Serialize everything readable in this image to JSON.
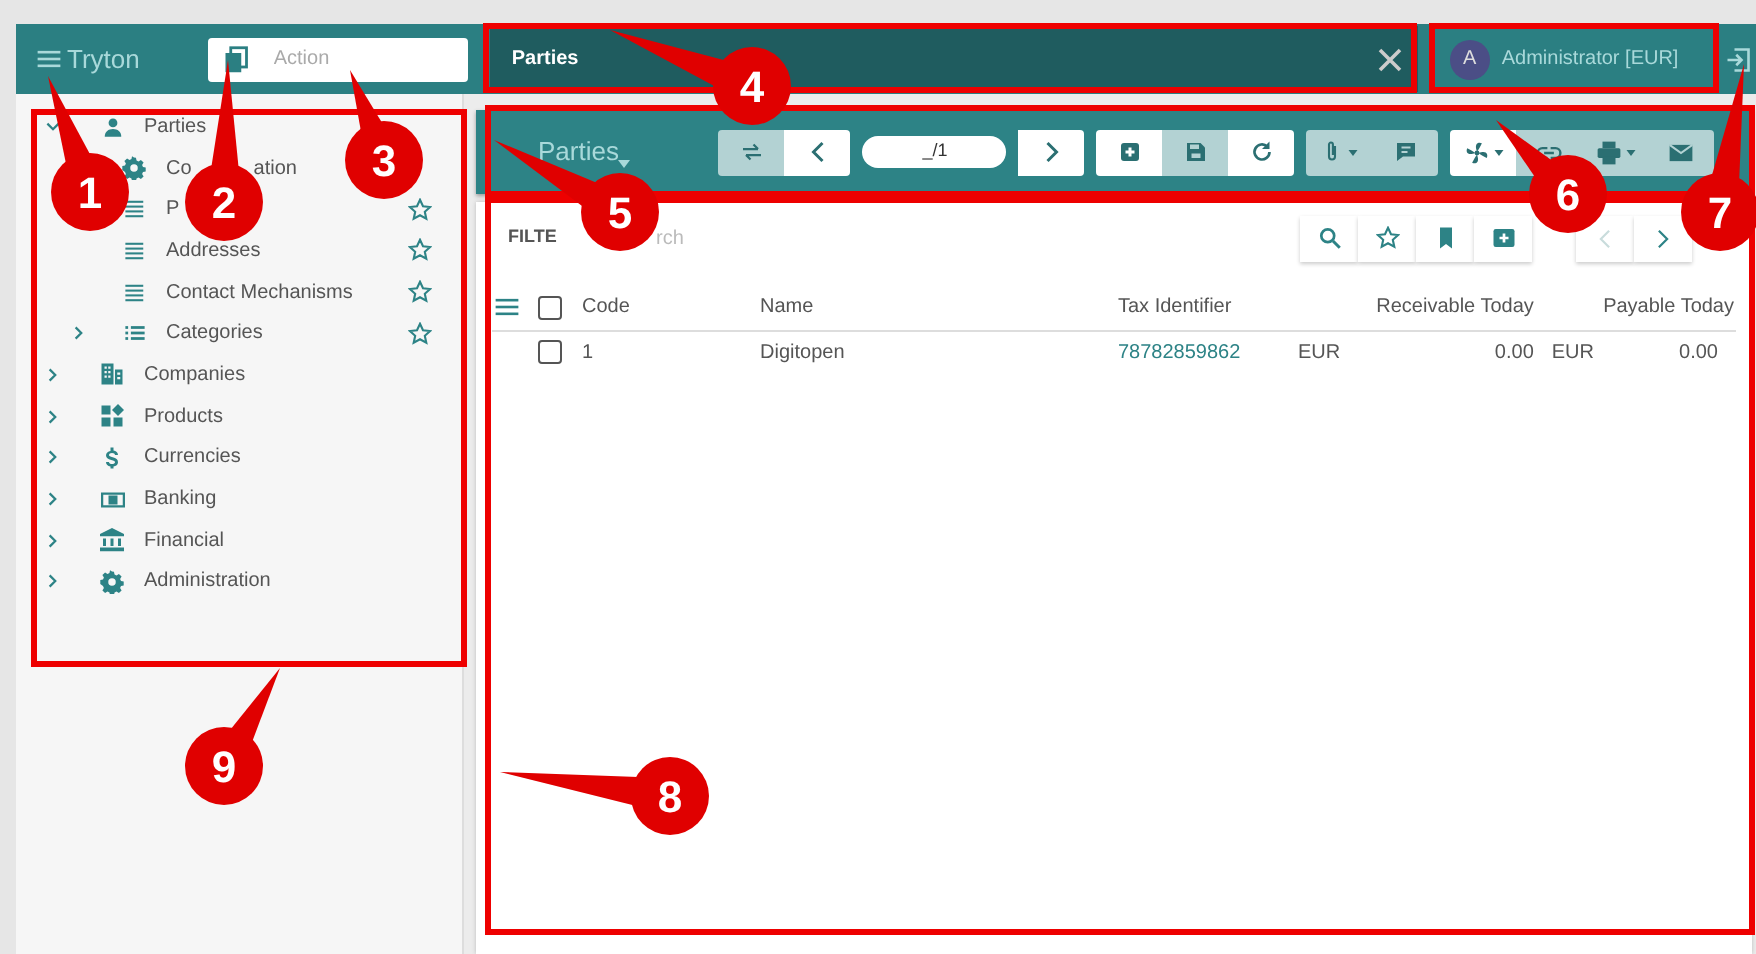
{
  "header": {
    "app_title": "Tryton",
    "action_search": {
      "placeholder": "Action"
    },
    "tabs": [
      {
        "label": "Parties",
        "selected": true
      }
    ],
    "user": {
      "avatar": "A",
      "name": "Administrator [EUR]"
    }
  },
  "menu": [
    {
      "label": "Parties",
      "expanded": true,
      "children": [
        {
          "label": "Co",
          "label_continued": "ation"
        },
        {
          "label": "P",
          "favorite": false
        },
        {
          "label": "Addresses",
          "favorite": false
        },
        {
          "label": "Contact Mechanisms",
          "favorite": false
        },
        {
          "label": "Categories",
          "expanded": false,
          "favorite": false
        }
      ]
    },
    {
      "label": "Companies",
      "expanded": false
    },
    {
      "label": "Products",
      "expanded": false
    },
    {
      "label": "Currencies",
      "expanded": false
    },
    {
      "label": "Banking",
      "expanded": false
    },
    {
      "label": "Financial",
      "expanded": false
    },
    {
      "label": "Administration",
      "expanded": false
    }
  ],
  "toolbar": {
    "title": "Parties",
    "pager": "_/1",
    "groups": [
      [
        {
          "kind": "switch",
          "disabled": true
        },
        {
          "kind": "previous",
          "disabled": false
        }
      ],
      [
        {
          "kind": "next",
          "disabled": false
        }
      ],
      [
        {
          "kind": "new",
          "disabled": false
        },
        {
          "kind": "save",
          "disabled": true
        },
        {
          "kind": "reload",
          "disabled": false
        }
      ],
      [
        {
          "kind": "attach",
          "disabled": true,
          "menu": true
        },
        {
          "kind": "note",
          "disabled": true
        }
      ],
      [
        {
          "kind": "action",
          "disabled": false,
          "menu": true
        },
        {
          "kind": "link",
          "disabled": true
        },
        {
          "kind": "print",
          "disabled": true,
          "menu": true
        },
        {
          "kind": "email",
          "disabled": true
        }
      ]
    ]
  },
  "filter": {
    "label": "FILTE",
    "placeholder": "rch",
    "pager": [
      {
        "kind": "previous",
        "disabled": true
      },
      {
        "kind": "next",
        "disabled": false
      }
    ]
  },
  "table": {
    "all_selected": false,
    "columns": [
      "Code",
      "Name",
      "Tax Identifier",
      "Receivable Today",
      "Payable Today"
    ],
    "rows": [
      {
        "selected": false,
        "code": "1",
        "name": "Digitopen",
        "tax_identifier": "78782859862",
        "receivable": {
          "currency": "EUR",
          "amount": "0.00"
        },
        "payable": {
          "currency": "EUR",
          "amount": "0.00"
        }
      }
    ]
  },
  "callouts": [
    {
      "number": "1"
    },
    {
      "number": "2"
    },
    {
      "number": "3"
    },
    {
      "number": "4"
    },
    {
      "number": "5"
    },
    {
      "number": "6"
    },
    {
      "number": "7"
    },
    {
      "number": "8"
    },
    {
      "number": "9"
    }
  ]
}
